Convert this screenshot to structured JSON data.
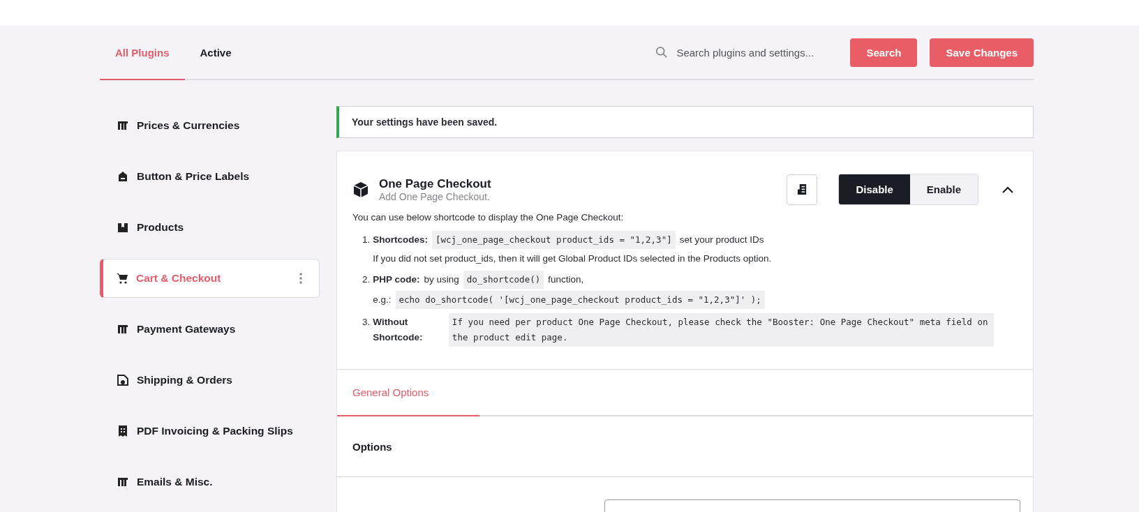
{
  "tabs": [
    {
      "label": "All Plugins",
      "selected": true
    },
    {
      "label": "Active",
      "selected": false
    }
  ],
  "search": {
    "placeholder": "Search plugins and settings..."
  },
  "buttons": [
    {
      "label": "Search"
    },
    {
      "label": "Save Changes"
    }
  ],
  "sidebar": {
    "items": [
      {
        "label": "Prices & Currencies",
        "kind": "columns",
        "selected": false
      },
      {
        "label": "Button & Price Labels",
        "kind": "tag",
        "selected": false
      },
      {
        "label": "Products",
        "kind": "box",
        "selected": false
      },
      {
        "label": "Cart & Checkout",
        "kind": "cart",
        "selected": true
      },
      {
        "label": "Payment Gateways",
        "kind": "columns",
        "selected": false
      },
      {
        "label": "Shipping & Orders",
        "kind": "truck",
        "selected": false
      },
      {
        "label": "PDF Invoicing & Packing Slips",
        "kind": "receipt",
        "selected": false
      },
      {
        "label": "Emails & Misc.",
        "kind": "columns",
        "selected": false
      }
    ]
  },
  "notice": "Your settings have been saved.",
  "module": {
    "title": "One Page Checkout",
    "subtitle": "Add One Page Checkout.",
    "expanded": true,
    "toggle": [
      {
        "label": "Disable",
        "selected": true
      },
      {
        "label": "Enable",
        "selected": false
      }
    ],
    "intro": "You can use below shortcode to display the One Page Checkout:",
    "steps": [
      {
        "number": "1.",
        "lines": [
          [
            {
              "kind": "bold",
              "text": "Shortcodes:"
            },
            {
              "kind": "code",
              "text": "[wcj_one_page_checkout product_ids = \"1,2,3\"]"
            },
            {
              "kind": "text",
              "text": "set your product IDs"
            }
          ],
          [
            {
              "kind": "text",
              "text": "If you did not set product_ids, then it will get Global Product IDs selected in the Products option."
            }
          ]
        ]
      },
      {
        "number": "2.",
        "lines": [
          [
            {
              "kind": "bold",
              "text": "PHP code:"
            },
            {
              "kind": "text",
              "text": "by using"
            },
            {
              "kind": "code",
              "text": "do_shortcode()"
            },
            {
              "kind": "text",
              "text": "function,"
            }
          ],
          [
            {
              "kind": "text",
              "text": "e.g.:"
            },
            {
              "kind": "code",
              "text": "echo do_shortcode( '[wcj_one_page_checkout product_ids = \"1,2,3\"]' );"
            }
          ]
        ]
      },
      {
        "number": "3.",
        "lines": [
          [
            {
              "kind": "bold",
              "text": "Without Shortcode:"
            },
            {
              "kind": "code",
              "text": "If you need per product One Page Checkout, please check the \"Booster: One Page Checkout\" meta field on the product edit page."
            }
          ]
        ]
      }
    ]
  },
  "section_tabs": [
    {
      "label": "General Options",
      "selected": true
    }
  ],
  "options_heading": "Options"
}
